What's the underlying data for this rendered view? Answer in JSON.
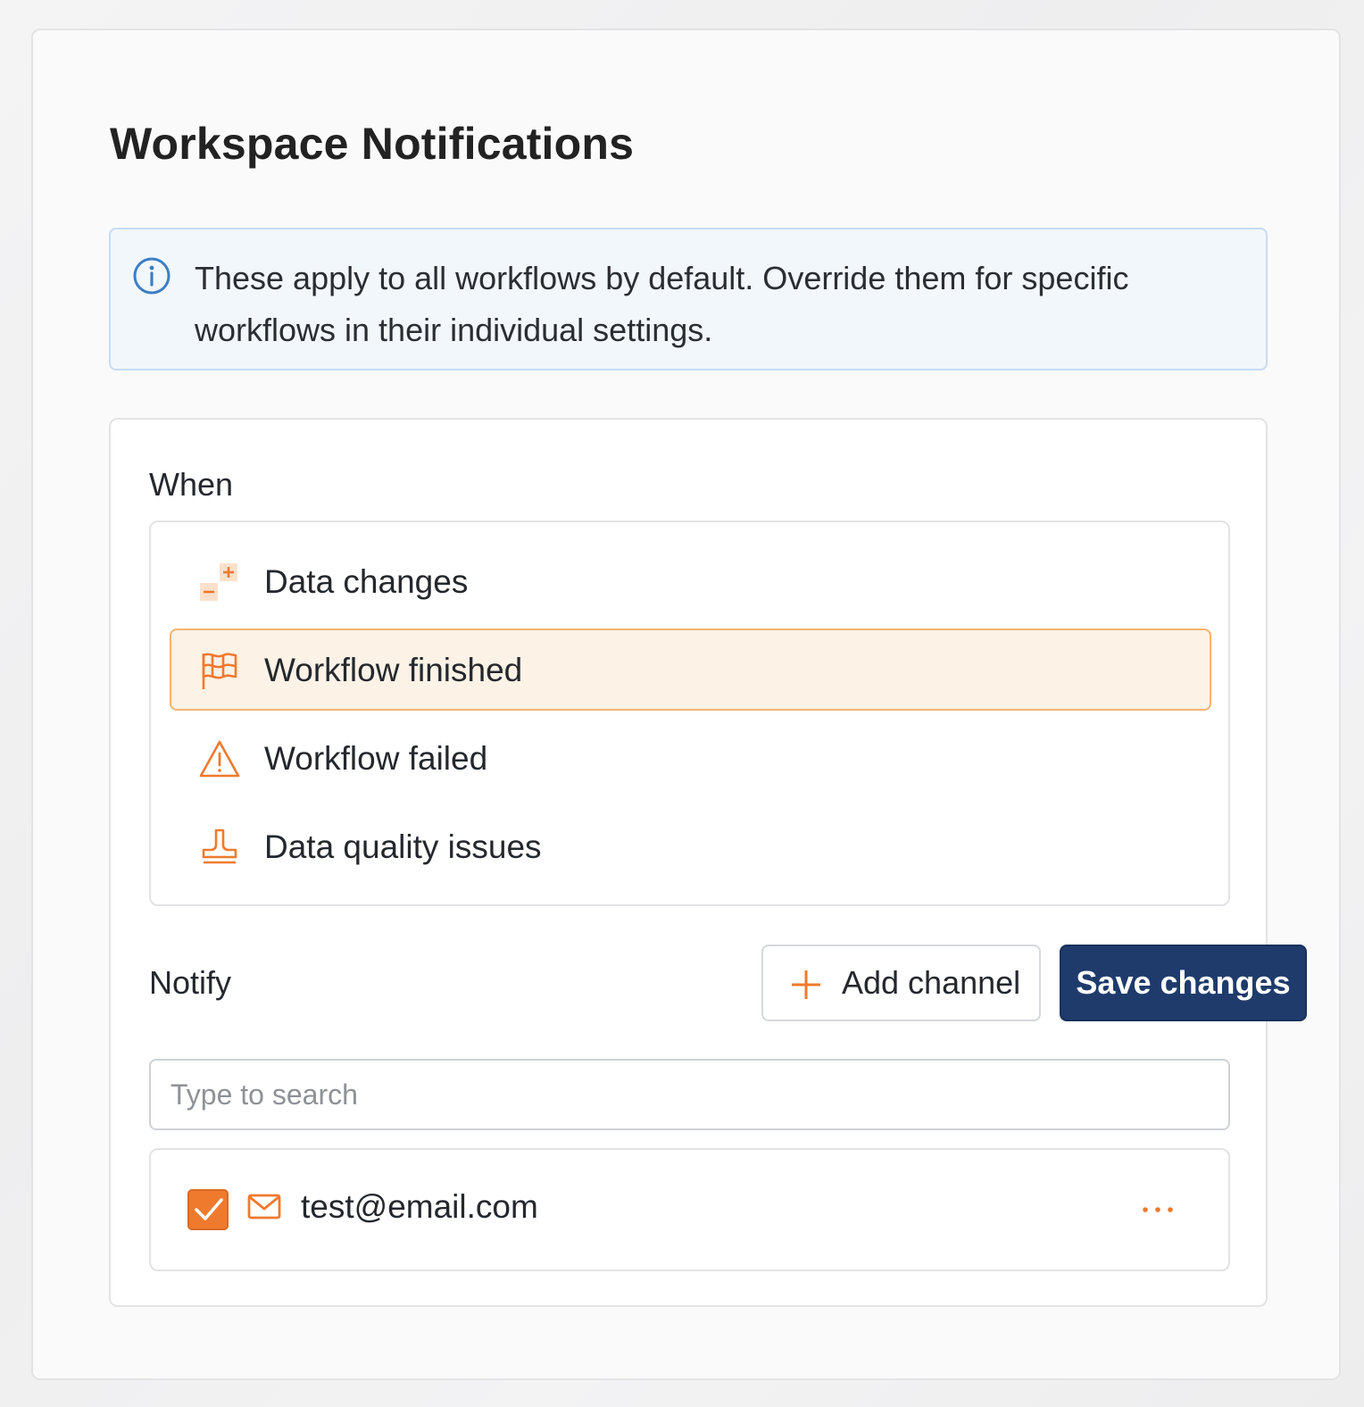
{
  "page": {
    "title": "Workspace Notifications"
  },
  "info_banner": {
    "icon": "info-icon",
    "text": "These apply to all workflows by default. Override them for specific workflows in their individual settings."
  },
  "when": {
    "label": "When",
    "items": [
      {
        "label": "Data changes",
        "icon": "data-changes-icon",
        "selected": false
      },
      {
        "label": "Workflow finished",
        "icon": "flag-icon",
        "selected": true
      },
      {
        "label": "Workflow failed",
        "icon": "warning-icon",
        "selected": false
      },
      {
        "label": "Data quality issues",
        "icon": "stamp-icon",
        "selected": false
      }
    ]
  },
  "notify": {
    "label": "Notify",
    "add_channel_label": "Add channel",
    "save_label": "Save changes",
    "search_placeholder": "Type to search",
    "search_value": "",
    "recipients": [
      {
        "email": "test@email.com",
        "checked": true,
        "icon": "mail-icon"
      }
    ]
  },
  "colors": {
    "accent": "#ef7a2e",
    "primary": "#1e3b6c",
    "info_bg": "#f2f7fc",
    "info_border": "#c7dcf1",
    "selected_bg": "#fdf2e6",
    "selected_border": "#f2b471"
  }
}
